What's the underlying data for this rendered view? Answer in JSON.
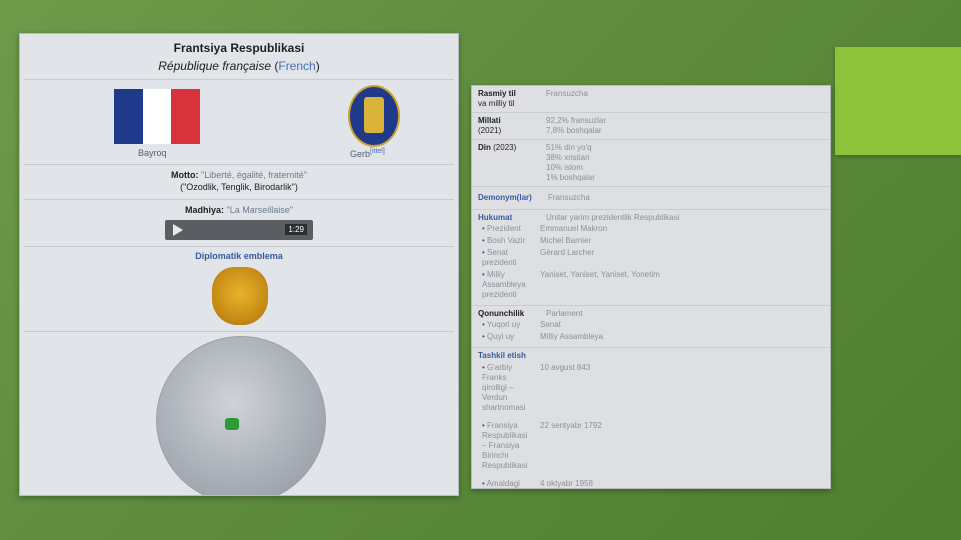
{
  "colors": {
    "background": "#5e8c3c",
    "accent_square": "#8dc23a",
    "link": "#4a6fb5",
    "flag_blue": "#1f3a8a",
    "flag_white": "#ffffff",
    "flag_red": "#d8323c"
  },
  "left": {
    "title": "Frantsiya Respublikasi",
    "native_name": "République française",
    "native_lang_open": "(",
    "native_lang": "French",
    "native_lang_close": ")",
    "flag_caption": "Bayroq",
    "coat_caption": "Gerb",
    "coat_caption_sup": "[ittel]",
    "motto_label": "Motto:",
    "motto_text": "\"Liberté, égalité, fraternité\"",
    "motto_translation": "(\"Ozodlik, Tenglik, Birodarlik\")",
    "anthem_label": "Madhiya:",
    "anthem_text": "\"La Marseillaise\"",
    "anthem_duration": "1:29",
    "emblem_title": "Diplomatik emblema"
  },
  "right": {
    "rows": [
      {
        "label": "Rasmiy til",
        "label_sub": "va milliy til",
        "value_lines": [
          "Fransuzcha"
        ]
      },
      {
        "label": "Millati",
        "label_sub": "(2021)",
        "value_lines": [
          "92,2% fransuzlar",
          "7,8% boshqalar"
        ]
      },
      {
        "label": "Din",
        "label_sub": "(2023)",
        "value_lines": [
          "51% din yo'q",
          "38% xristian",
          "10% islom",
          "1% boshqalar"
        ]
      }
    ],
    "demonym_label": "Demonym(lar)",
    "demonym_value": "Fransuzcha",
    "gov_label": "Hukumat",
    "gov_value": "Unitar yarim prezidentlik Respublikasi",
    "gov_items": [
      {
        "label": "Prezident",
        "value": "Emmanuel Makron"
      },
      {
        "label": "Bosh Vazir",
        "value": "Michel Barnier"
      },
      {
        "label": "Senat prezidenti",
        "value": "Gérard Larcher"
      },
      {
        "label": "Milliy Assambleya prezidenti",
        "value": "Yaniset, Yaniset, Yaniset, Yonetim"
      }
    ],
    "leg_label": "Qonunchilik",
    "leg_value": "Parlament",
    "leg_items": [
      {
        "label": "Yuqori uy",
        "value": "Senat"
      },
      {
        "label": "Quyi uy",
        "value": "Milliy Assambleya"
      }
    ],
    "found_label": "Tashkil etish",
    "found_items": [
      {
        "label": "G'arbiy Franks qirolligi – Verdun shartnomasi",
        "value": "10 avgust 843"
      },
      {
        "label": "Fransiya Respublikasi – Fransiya Birinchi Respublikasi",
        "value": "22 sentyabr 1792"
      },
      {
        "label": "Amaldagi Konstitutsiya – Fransiya Beshinchi Respublikasi",
        "value": "4 oktyabr 1958"
      }
    ]
  }
}
